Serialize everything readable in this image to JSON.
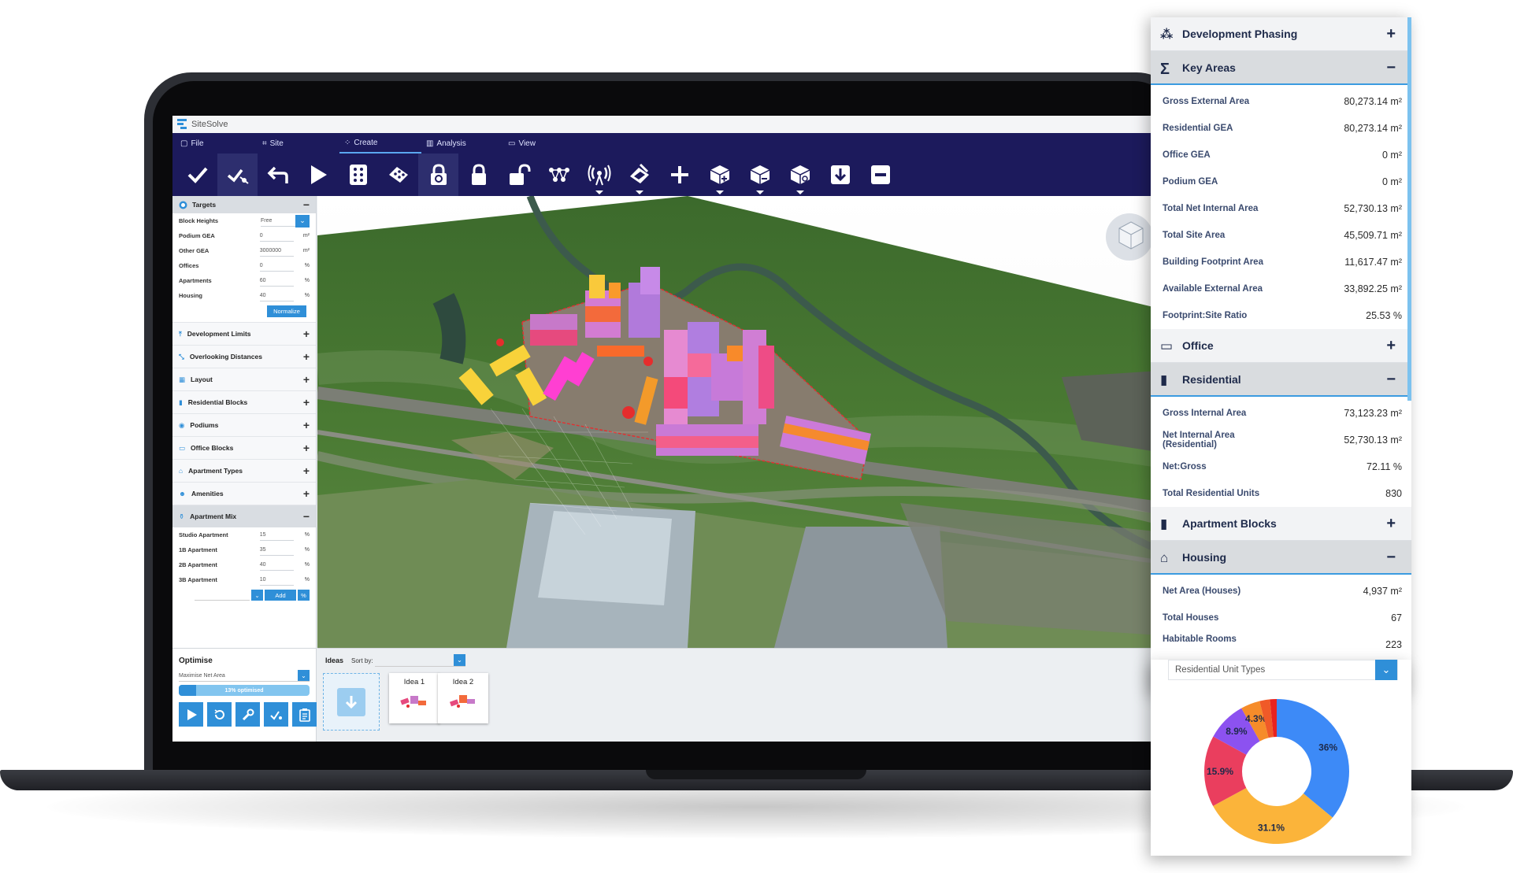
{
  "app": {
    "title": "SiteSolve",
    "menu": [
      {
        "label": "File",
        "icon": "file-icon"
      },
      {
        "label": "Site",
        "icon": "site-icon"
      },
      {
        "label": "Create",
        "icon": "create-icon"
      },
      {
        "label": "Analysis",
        "icon": "analysis-icon"
      },
      {
        "label": "View",
        "icon": "view-icon"
      }
    ],
    "active_menu": "Create",
    "toolbar_icons": [
      "check-icon",
      "draw-path-icon",
      "undo-icon",
      "play-icon",
      "grid-icon",
      "tiles-icon",
      "lock-rotate-icon",
      "lock-icon",
      "unlock-icon",
      "network-icon",
      "signal-icon",
      "edit-blocks-icon",
      "plus-icon",
      "box-add-icon",
      "box-remove-icon",
      "box-edit-icon",
      "download-icon",
      "minus-icon"
    ]
  },
  "targets": {
    "title": "Targets",
    "rows": [
      {
        "label": "Block Heights",
        "value": "Free",
        "unit": ""
      },
      {
        "label": "Podium GEA",
        "value": "0",
        "unit": "m²"
      },
      {
        "label": "Other GEA",
        "value": "3000000",
        "unit": "m²"
      },
      {
        "label": "Offices",
        "value": "0",
        "unit": "%"
      },
      {
        "label": "Apartments",
        "value": "60",
        "unit": "%"
      },
      {
        "label": "Housing",
        "value": "40",
        "unit": "%"
      }
    ],
    "normalize_label": "Normalize"
  },
  "sections": [
    {
      "label": "Development Limits",
      "icon": "height-limit-icon"
    },
    {
      "label": "Overlooking Distances",
      "icon": "overlook-icon"
    },
    {
      "label": "Layout",
      "icon": "layout-icon"
    },
    {
      "label": "Residential Blocks",
      "icon": "building-icon"
    },
    {
      "label": "Podiums",
      "icon": "podium-icon"
    },
    {
      "label": "Office Blocks",
      "icon": "monitor-icon"
    },
    {
      "label": "Apartment Types",
      "icon": "apartment-icon"
    },
    {
      "label": "Amenities",
      "icon": "people-icon"
    }
  ],
  "apartment_mix": {
    "title": "Apartment Mix",
    "rows": [
      {
        "label": "Studio Apartment",
        "value": "15",
        "unit": "%"
      },
      {
        "label": "1B Apartment",
        "value": "35",
        "unit": "%"
      },
      {
        "label": "2B Apartment",
        "value": "40",
        "unit": "%"
      },
      {
        "label": "3B Apartment",
        "value": "10",
        "unit": "%"
      }
    ],
    "add_label": "Add",
    "unit_btn": "%"
  },
  "optimise": {
    "title": "Optimise",
    "select_value": "Maximise Net Area",
    "progress_text": "13% optimised",
    "progress_fraction": 0.13
  },
  "ideas": {
    "label": "Ideas",
    "sort_label": "Sort by:",
    "cards": [
      "Idea 1",
      "Idea 2"
    ]
  },
  "right_panel": {
    "development_phasing": "Development Phasing",
    "key_areas": {
      "title": "Key Areas",
      "rows": [
        {
          "label": "Gross External Area",
          "value": "80,273.14 m²"
        },
        {
          "label": "Residential GEA",
          "value": "80,273.14 m²"
        },
        {
          "label": "Office GEA",
          "value": "0 m²"
        },
        {
          "label": "Podium GEA",
          "value": "0 m²"
        },
        {
          "label": "Total Net Internal Area",
          "value": "52,730.13 m²"
        },
        {
          "label": "Total Site Area",
          "value": "45,509.71 m²"
        },
        {
          "label": "Building Footprint Area",
          "value": "11,617.47 m²"
        },
        {
          "label": "Available External Area",
          "value": "33,892.25 m²"
        },
        {
          "label": "Footprint:Site Ratio",
          "value": "25.53 %"
        }
      ]
    },
    "office": "Office",
    "residential": {
      "title": "Residential",
      "rows": [
        {
          "label": "Gross Internal Area",
          "value": "73,123.23 m²"
        },
        {
          "label": "Net Internal Area (Residential)",
          "value": "52,730.13 m²"
        },
        {
          "label": "Net:Gross",
          "value": "72.11 %"
        },
        {
          "label": "Total Residential Units",
          "value": "830"
        }
      ]
    },
    "apartment_blocks": "Apartment Blocks",
    "housing": {
      "title": "Housing",
      "rows": [
        {
          "label": "Net Area (Houses)",
          "value": "4,937 m²"
        },
        {
          "label": "Total Houses",
          "value": "67"
        },
        {
          "label": "Habitable Rooms",
          "value": "223"
        }
      ]
    },
    "unit_types_select": "Residential Unit Types"
  },
  "chart_data": {
    "type": "pie",
    "variant": "donut",
    "values": [
      36,
      31.1,
      15.9,
      8.9,
      4.3,
      2.3,
      1.5
    ],
    "labels": [
      "36%",
      "31.1%",
      "15.9%",
      "8.9%",
      "4.3%",
      "",
      ""
    ],
    "colors": [
      "#3d8af7",
      "#fbb43a",
      "#ea3e5e",
      "#8c52f0",
      "#f68c2a",
      "#f05a28",
      "#e8231f"
    ]
  }
}
